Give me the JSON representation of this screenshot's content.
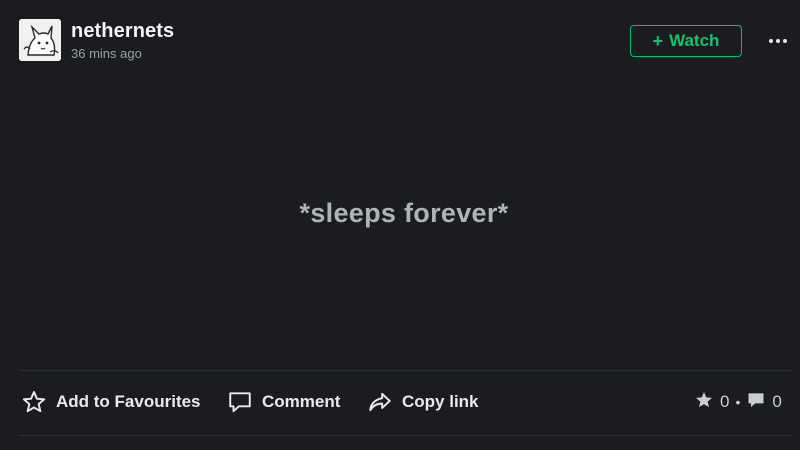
{
  "post": {
    "author": "nethernets",
    "timestamp": "36 mins ago",
    "text": "*sleeps forever*"
  },
  "header": {
    "watch_label": "Watch",
    "watch_plus": "+",
    "more_label": "•••"
  },
  "actions": {
    "favourite_label": "Add to Favourites",
    "comment_label": "Comment",
    "copy_link_label": "Copy link"
  },
  "stats": {
    "favourites": "0",
    "separator": "•",
    "comments": "0"
  },
  "colors": {
    "background": "#1a1c20",
    "accent_green": "#00c66a",
    "text_primary": "#e6e7e8",
    "text_muted": "#9aa0a6",
    "post_text": "#aeb3b8"
  },
  "icons": {
    "avatar": "cartoon-avatar",
    "favourite": "star-outline-icon",
    "comment": "speech-bubble-icon",
    "copy_link": "share-arrow-icon",
    "fav_count": "star-filled-icon",
    "comment_count": "speech-bubble-filled-icon",
    "more": "ellipsis-icon"
  }
}
